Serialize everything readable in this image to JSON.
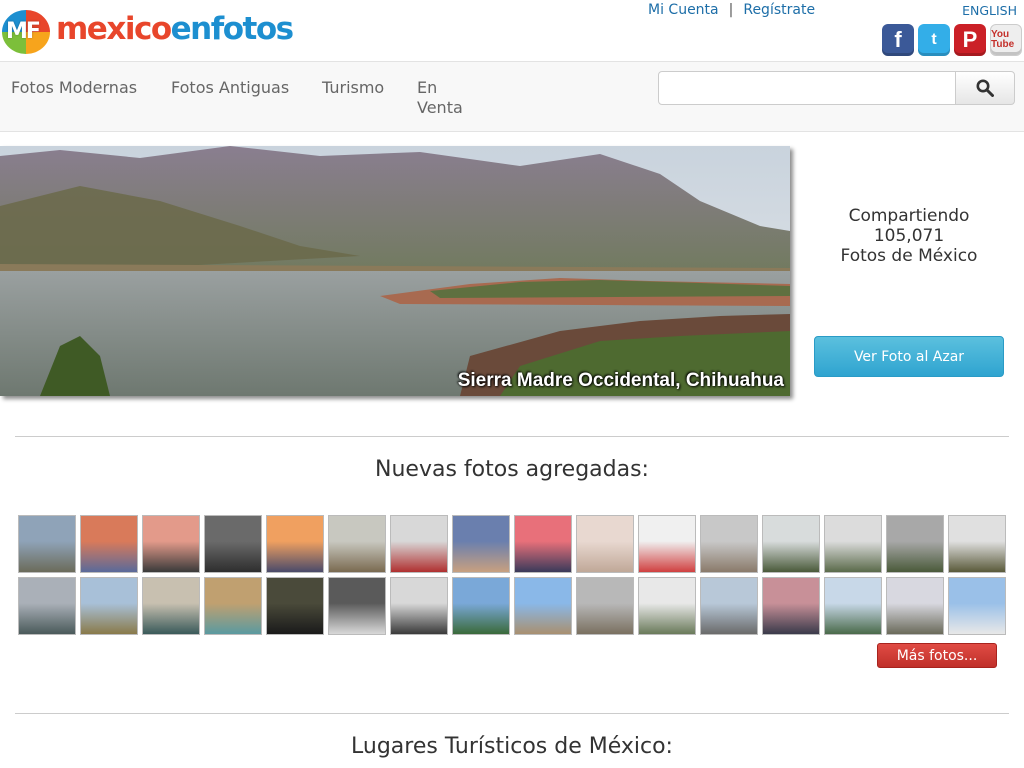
{
  "header": {
    "logo": {
      "badge": "MF",
      "text_part1": "mexico",
      "text_part2": "enfotos"
    },
    "account": {
      "my_account": "Mi Cuenta",
      "separator": "|",
      "register": "Regístrate"
    },
    "language": "ENGLISH",
    "social": [
      {
        "name": "facebook-icon",
        "glyph": "f"
      },
      {
        "name": "twitter-icon",
        "glyph": "t"
      },
      {
        "name": "pinterest-icon",
        "glyph": "P"
      },
      {
        "name": "youtube-icon",
        "glyph": "You Tube"
      }
    ]
  },
  "nav": {
    "items": [
      "Fotos Modernas",
      "Fotos Antiguas",
      "Turismo",
      "En Venta"
    ],
    "search": {
      "placeholder": "",
      "value": ""
    }
  },
  "hero": {
    "caption": "Sierra Madre Occidental, Chihuahua"
  },
  "stats": {
    "line1": "Compartiendo",
    "count": "105,071",
    "line3": "Fotos de México"
  },
  "random_button": "Ver Foto al Azar",
  "new_photos": {
    "title": "Nuevas fotos agregadas:",
    "row1_colors": [
      [
        "#8fa3b8",
        "#6b6b5a"
      ],
      [
        "#d97a5a",
        "#5a6a9a"
      ],
      [
        "#e39a8a",
        "#3a3a3a"
      ],
      [
        "#6a6a6a",
        "#2e2e2e"
      ],
      [
        "#f0a060",
        "#4a4a6a"
      ],
      [
        "#c8c8c0",
        "#7a6a50"
      ],
      [
        "#d8d8d8",
        "#b03030"
      ],
      [
        "#6a7fae",
        "#c8a080"
      ],
      [
        "#e8707a",
        "#3a3a5a"
      ],
      [
        "#e8d8d0",
        "#c0a898"
      ],
      [
        "#f0f0f0",
        "#d04040"
      ],
      [
        "#c8c8c8",
        "#8a7a6a"
      ],
      [
        "#d8dcdc",
        "#4a5a3a"
      ],
      [
        "#dcdcdc",
        "#5a6a4a"
      ],
      [
        "#a8a8a8",
        "#4a5a3a"
      ],
      [
        "#e0e0e0",
        "#5a5a3a"
      ]
    ],
    "row2_colors": [
      [
        "#aab0b8",
        "#4a5a5a"
      ],
      [
        "#a8c0d8",
        "#8a7a4a"
      ],
      [
        "#c8c0b0",
        "#3a5a5a"
      ],
      [
        "#c0a070",
        "#5a9aa0"
      ],
      [
        "#4a4a3a",
        "#1a1a1a"
      ],
      [
        "#5a5a5a",
        "#d8d8d8"
      ],
      [
        "#d8d8d8",
        "#3a3a3a"
      ],
      [
        "#7aa8d8",
        "#3a6a3a"
      ],
      [
        "#8ab8e8",
        "#a89070"
      ],
      [
        "#b8b8b8",
        "#7a7060"
      ],
      [
        "#e8e8e8",
        "#6a7a5a"
      ],
      [
        "#b8c8d8",
        "#6a6a6a"
      ],
      [
        "#c89098",
        "#3a3a4a"
      ],
      [
        "#c8d8e8",
        "#4a6a4a"
      ],
      [
        "#d8d8e0",
        "#6a6a5a"
      ],
      [
        "#9ac0e8",
        "#e8e8e8"
      ]
    ],
    "more_button": "Más fotos..."
  },
  "places": {
    "title": "Lugares Turísticos de México:"
  },
  "colors": {
    "accent_blue": "#1d6ea8",
    "button_blue": "#2fa4d0",
    "button_red": "#c0302a"
  }
}
